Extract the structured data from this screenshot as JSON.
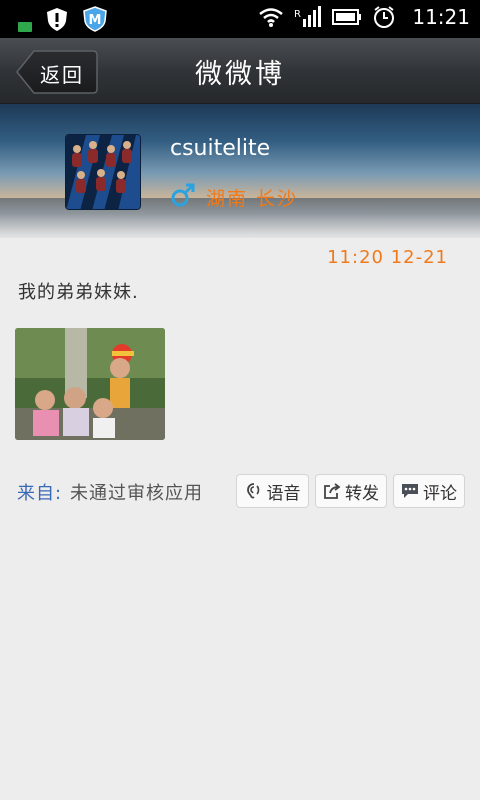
{
  "status_bar": {
    "time": "11:21",
    "icons": [
      "notification-dot-icon",
      "shield-alert-icon",
      "m-app-icon",
      "wifi-icon",
      "signal-icon",
      "battery-icon",
      "alarm-icon"
    ]
  },
  "header": {
    "back_label": "返回",
    "title": "微微博"
  },
  "profile": {
    "username": "csuitelite",
    "gender_icon": "male-icon",
    "location": "湖南 长沙",
    "accent_color": "#f07a1a"
  },
  "post": {
    "timestamp": "11:20 12-21",
    "text": "我的弟弟妹妹.",
    "image_icon": "photo-thumbnail",
    "source_label": "来自:",
    "source_value": "未通过审核应用"
  },
  "actions": {
    "voice_label": "语音",
    "forward_label": "转发",
    "comment_label": "评论"
  }
}
